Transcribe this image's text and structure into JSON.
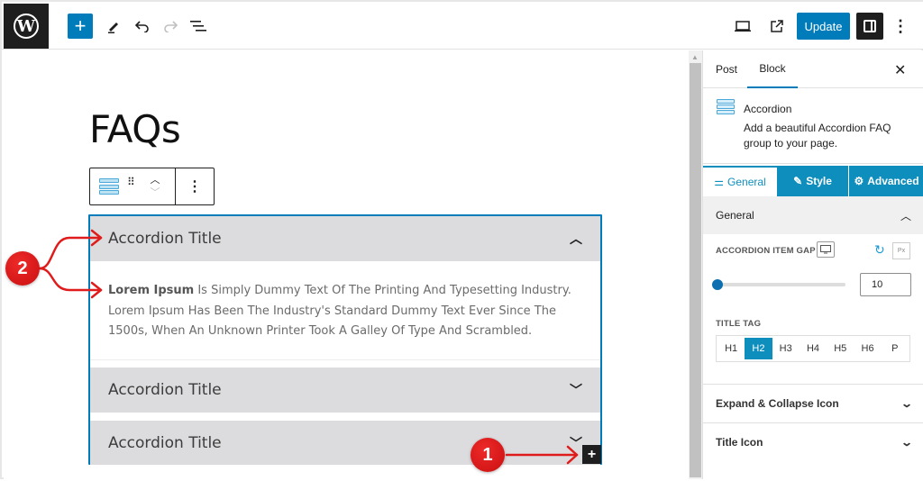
{
  "topbar": {
    "logo": "wordpress-logo",
    "add_block_label": "+",
    "update_label": "Update",
    "icons": {
      "pencil": "✎",
      "undo": "↶",
      "redo": "↷",
      "list_view": "☰",
      "preview": "▭",
      "external": "⧉",
      "more": "⋮"
    }
  },
  "editor": {
    "page_title": "FAQs",
    "block_toolbar": {
      "drag_glyph": "⠿",
      "move_up": "︿",
      "move_down": "﹀",
      "options": "⋮"
    },
    "accordion": {
      "items": [
        {
          "title": "Accordion Title",
          "expanded": true,
          "chevron": "︿",
          "body_bold": "Lorem Ipsum",
          "body_text": " Is Simply Dummy Text Of The Printing And Typesetting Industry. Lorem Ipsum Has Been The Industry's Standard Dummy Text Ever Since The 1500s, When An Unknown Printer Took A Galley Of Type And Scrambled."
        },
        {
          "title": "Accordion Title",
          "expanded": false,
          "chevron": "﹀"
        },
        {
          "title": "Accordion Title",
          "expanded": false,
          "chevron": "﹀"
        }
      ],
      "appender_label": "+"
    },
    "annotations": [
      {
        "number": "1",
        "target": "add-item-button"
      },
      {
        "number": "2",
        "target": "accordion-title-and-content"
      }
    ]
  },
  "sidebar": {
    "tabs": [
      {
        "label": "Post",
        "active": false
      },
      {
        "label": "Block",
        "active": true
      }
    ],
    "close_glyph": "✕",
    "block_card": {
      "name": "Accordion",
      "description": "Add a beautiful Accordion FAQ group to your page."
    },
    "panel_tabs": [
      {
        "label": "General",
        "icon": "sliders-icon",
        "glyph": "⚌",
        "active": true
      },
      {
        "label": "Style",
        "icon": "edit-icon",
        "glyph": "✎",
        "active": false
      },
      {
        "label": "Advanced",
        "icon": "gear-icon",
        "glyph": "⚙",
        "active": false
      }
    ],
    "general_section": {
      "title": "General",
      "chevron": "︿",
      "item_gap": {
        "label": "ACCORDION ITEM GAP",
        "device_glyph": "🖵",
        "reset_glyph": "↻",
        "unit": "Px",
        "value": "10",
        "slider_fraction": 0.0
      },
      "title_tag": {
        "label": "TITLE TAG",
        "options": [
          "H1",
          "H2",
          "H3",
          "H4",
          "H5",
          "H6",
          "P"
        ],
        "selected": "H2"
      }
    },
    "collapsed_sections": [
      {
        "title": "Expand & Collapse Icon",
        "chevron": "﹀"
      },
      {
        "title": "Title Icon",
        "chevron": "﹀"
      }
    ]
  },
  "colors": {
    "wp_blue": "#007cba",
    "plugin_teal": "#0e8ebd",
    "annotation_red": "#e01b1b",
    "accordion_header_bg": "#dcdcde"
  }
}
